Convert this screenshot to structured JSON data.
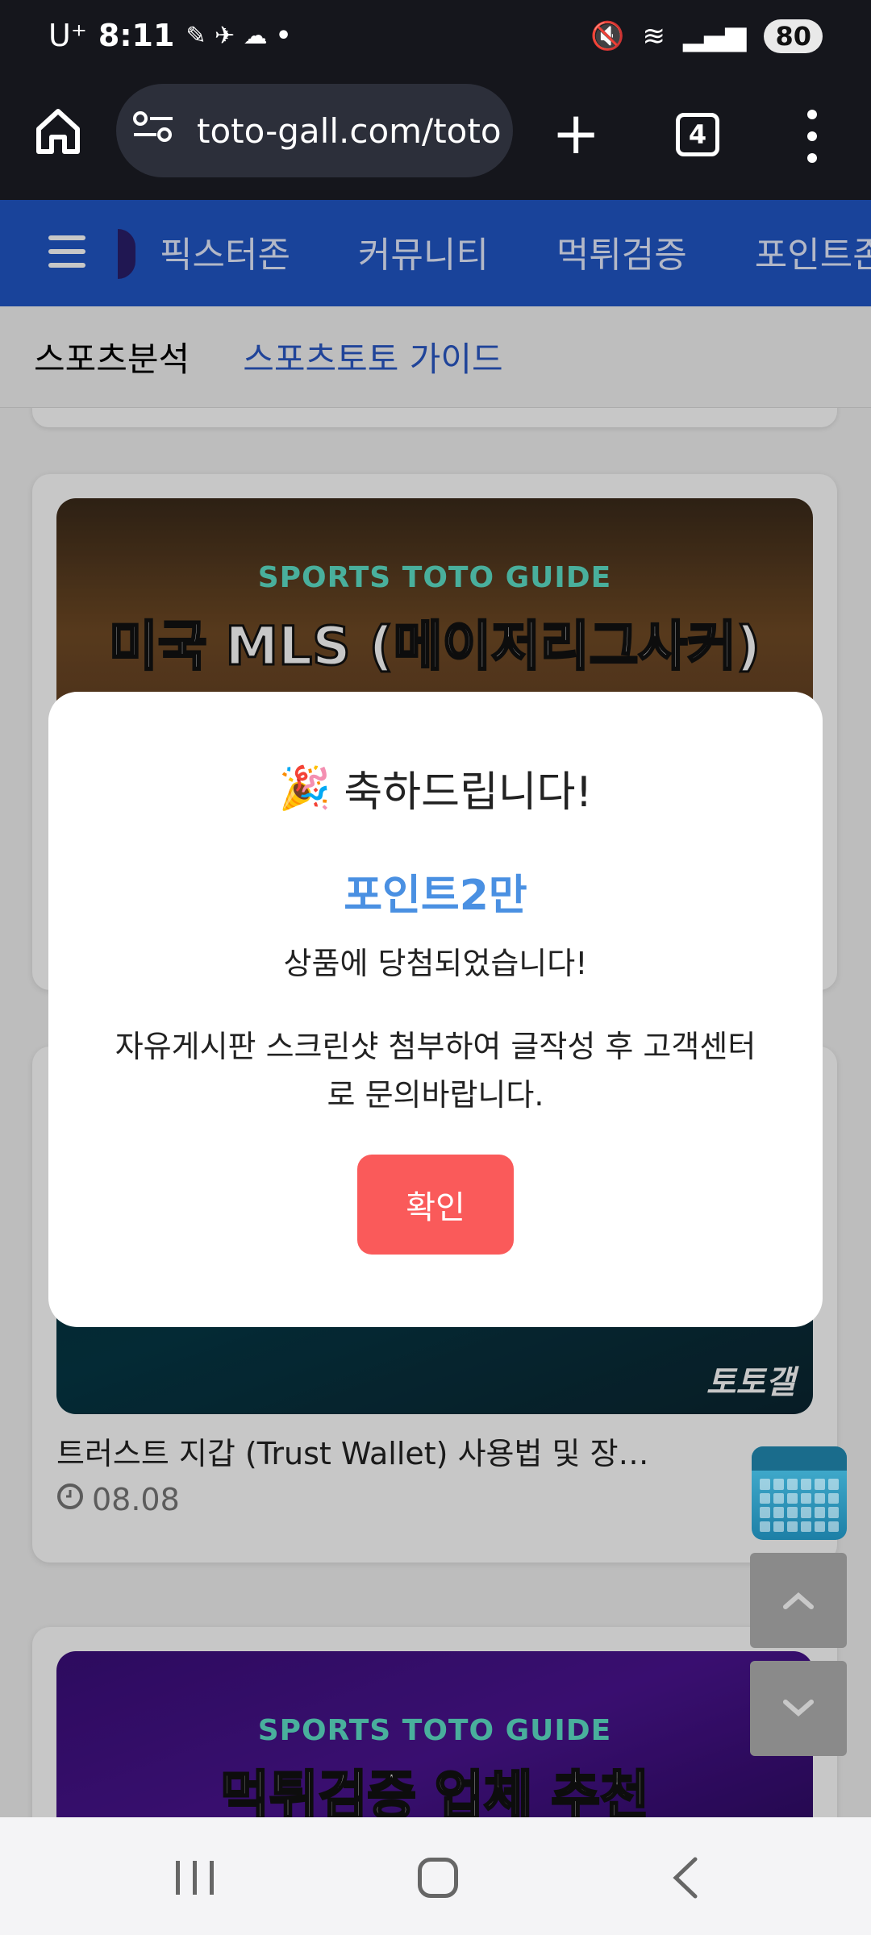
{
  "status_bar": {
    "carrier": "U⁺",
    "time": "8:11",
    "battery": "80"
  },
  "browser": {
    "url": "toto-gall.com/toto",
    "tab_count": "4",
    "icons": [
      "home-icon",
      "site-info-icon",
      "plus-icon",
      "tab-switcher-icon",
      "more-vert-icon"
    ]
  },
  "site_nav": {
    "items": [
      "픽스터존",
      "커뮤니티",
      "먹튀검증",
      "포인트존"
    ]
  },
  "sub_nav": {
    "items": [
      "스포츠분석",
      "스포츠토토 가이드"
    ]
  },
  "cards": [
    {
      "guide_label": "SPORTS TOTO GUIDE",
      "headline": "미국 MLS (메이저리그사커)"
    },
    {
      "title": "트러스트 지갑 (Trust Wallet) 사용법 및 장…",
      "date": "08.08",
      "logo": "토토갤"
    },
    {
      "guide_label": "SPORTS TOTO GUIDE",
      "headline": "먹튀검증 업체 추천"
    }
  ],
  "modal": {
    "emoji": "🎉",
    "heading": "축하드립니다!",
    "prize": "포인트2만",
    "message1": "상품에 당첨되었습니다!",
    "message2": "자유게시판 스크린샷 첨부하여 글작성 후 고객센터로 문의바랍니다.",
    "confirm_label": "확인"
  },
  "colors": {
    "site_nav_bg": "#2156c6",
    "prize_text": "#4a90e2",
    "confirm_button": "#fa5a5a"
  }
}
